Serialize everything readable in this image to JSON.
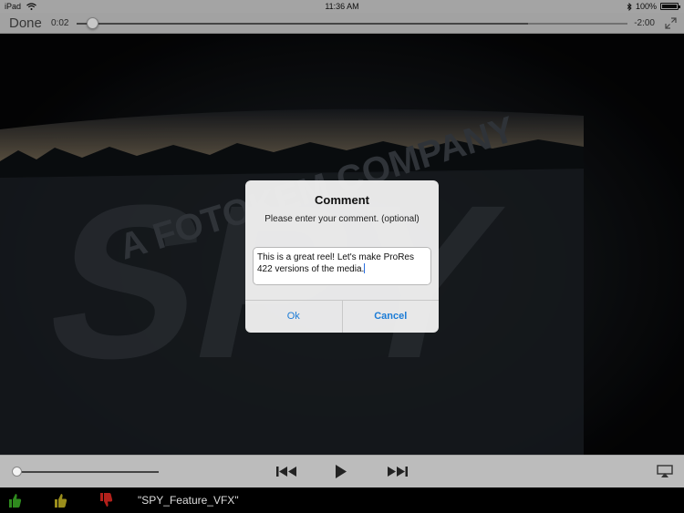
{
  "status_bar": {
    "device": "iPad",
    "time": "11:36 AM",
    "battery_percent": "100%",
    "battery_level": 1.0
  },
  "top_bar": {
    "done_label": "Done",
    "elapsed": "0:02",
    "remaining": "-2:00",
    "playback_progress": 0.02,
    "buffered_progress": 0.82
  },
  "video": {
    "overlay_text_1": "A FOTOKEM COMPANY",
    "overlay_text_2": "SPY"
  },
  "dialog": {
    "title": "Comment",
    "message": "Please enter your comment. (optional)",
    "comment_text": "This is a great reel! Let's make ProRes 422 versions of the media.",
    "ok_label": "Ok",
    "cancel_label": "Cancel"
  },
  "controls": {
    "volume_level": 0.0,
    "icons": [
      "previous-track-icon",
      "play-icon",
      "next-track-icon",
      "airplay-icon"
    ]
  },
  "bottom_bar": {
    "clip_name": "\"SPY_Feature_VFX\"",
    "icons": [
      "thumbs-up-green-icon",
      "thumbs-up-yellow-icon",
      "thumbs-down-red-icon"
    ],
    "colors": {
      "approve": "#2f8a1e",
      "neutral": "#9b8e1c",
      "reject": "#b3211b"
    }
  },
  "colors": {
    "accent": "#1c7cd6"
  }
}
